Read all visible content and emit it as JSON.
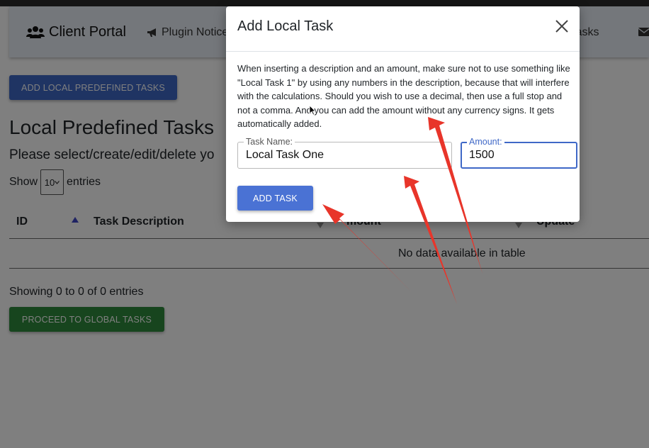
{
  "navbar": {
    "brand": "Client Portal",
    "plugin_notices": "Plugin Notice",
    "global_tasks_partial": "al Tasks"
  },
  "main": {
    "add_predefined_button": "ADD LOCAL PREDEFINED TASKS",
    "title": "Local Predefined Tasks",
    "subtitle": "Please select/create/edit/delete yo",
    "show_label": "Show",
    "entries_value": "10",
    "entries_label": "entries",
    "table": {
      "columns": [
        "ID",
        "Task Description",
        "mount",
        "Update"
      ],
      "empty_message": "No data available in table"
    },
    "showing_info": "Showing 0 to 0 of 0 entries",
    "proceed_button": "PROCEED TO GLOBAL TASKS"
  },
  "modal": {
    "title": "Add Local Task",
    "description": "When inserting a description and an amount, make sure not to use something like \"Local Task 1\" by using any numbers in the description, because that will interfere with the calculations. Should you wish to use a decimal, then use a full stop and not a comma. And you can add the amount without any currency signs. It gets automatically added.",
    "task_name_label": "Task Name:",
    "task_name_value": "Local Task One",
    "amount_label": "Amount:",
    "amount_value": "1500",
    "add_button": "ADD TASK"
  },
  "colors": {
    "primary": "#3f68c7",
    "success": "#2e8b3c",
    "annotation_arrow": "#e8352a"
  },
  "icons": [
    "users-icon",
    "bullhorn-icon",
    "envelope-icon",
    "close-icon",
    "sort-up-icon",
    "sort-down-icon",
    "chevron-down-icon",
    "mouse-cursor-icon"
  ]
}
